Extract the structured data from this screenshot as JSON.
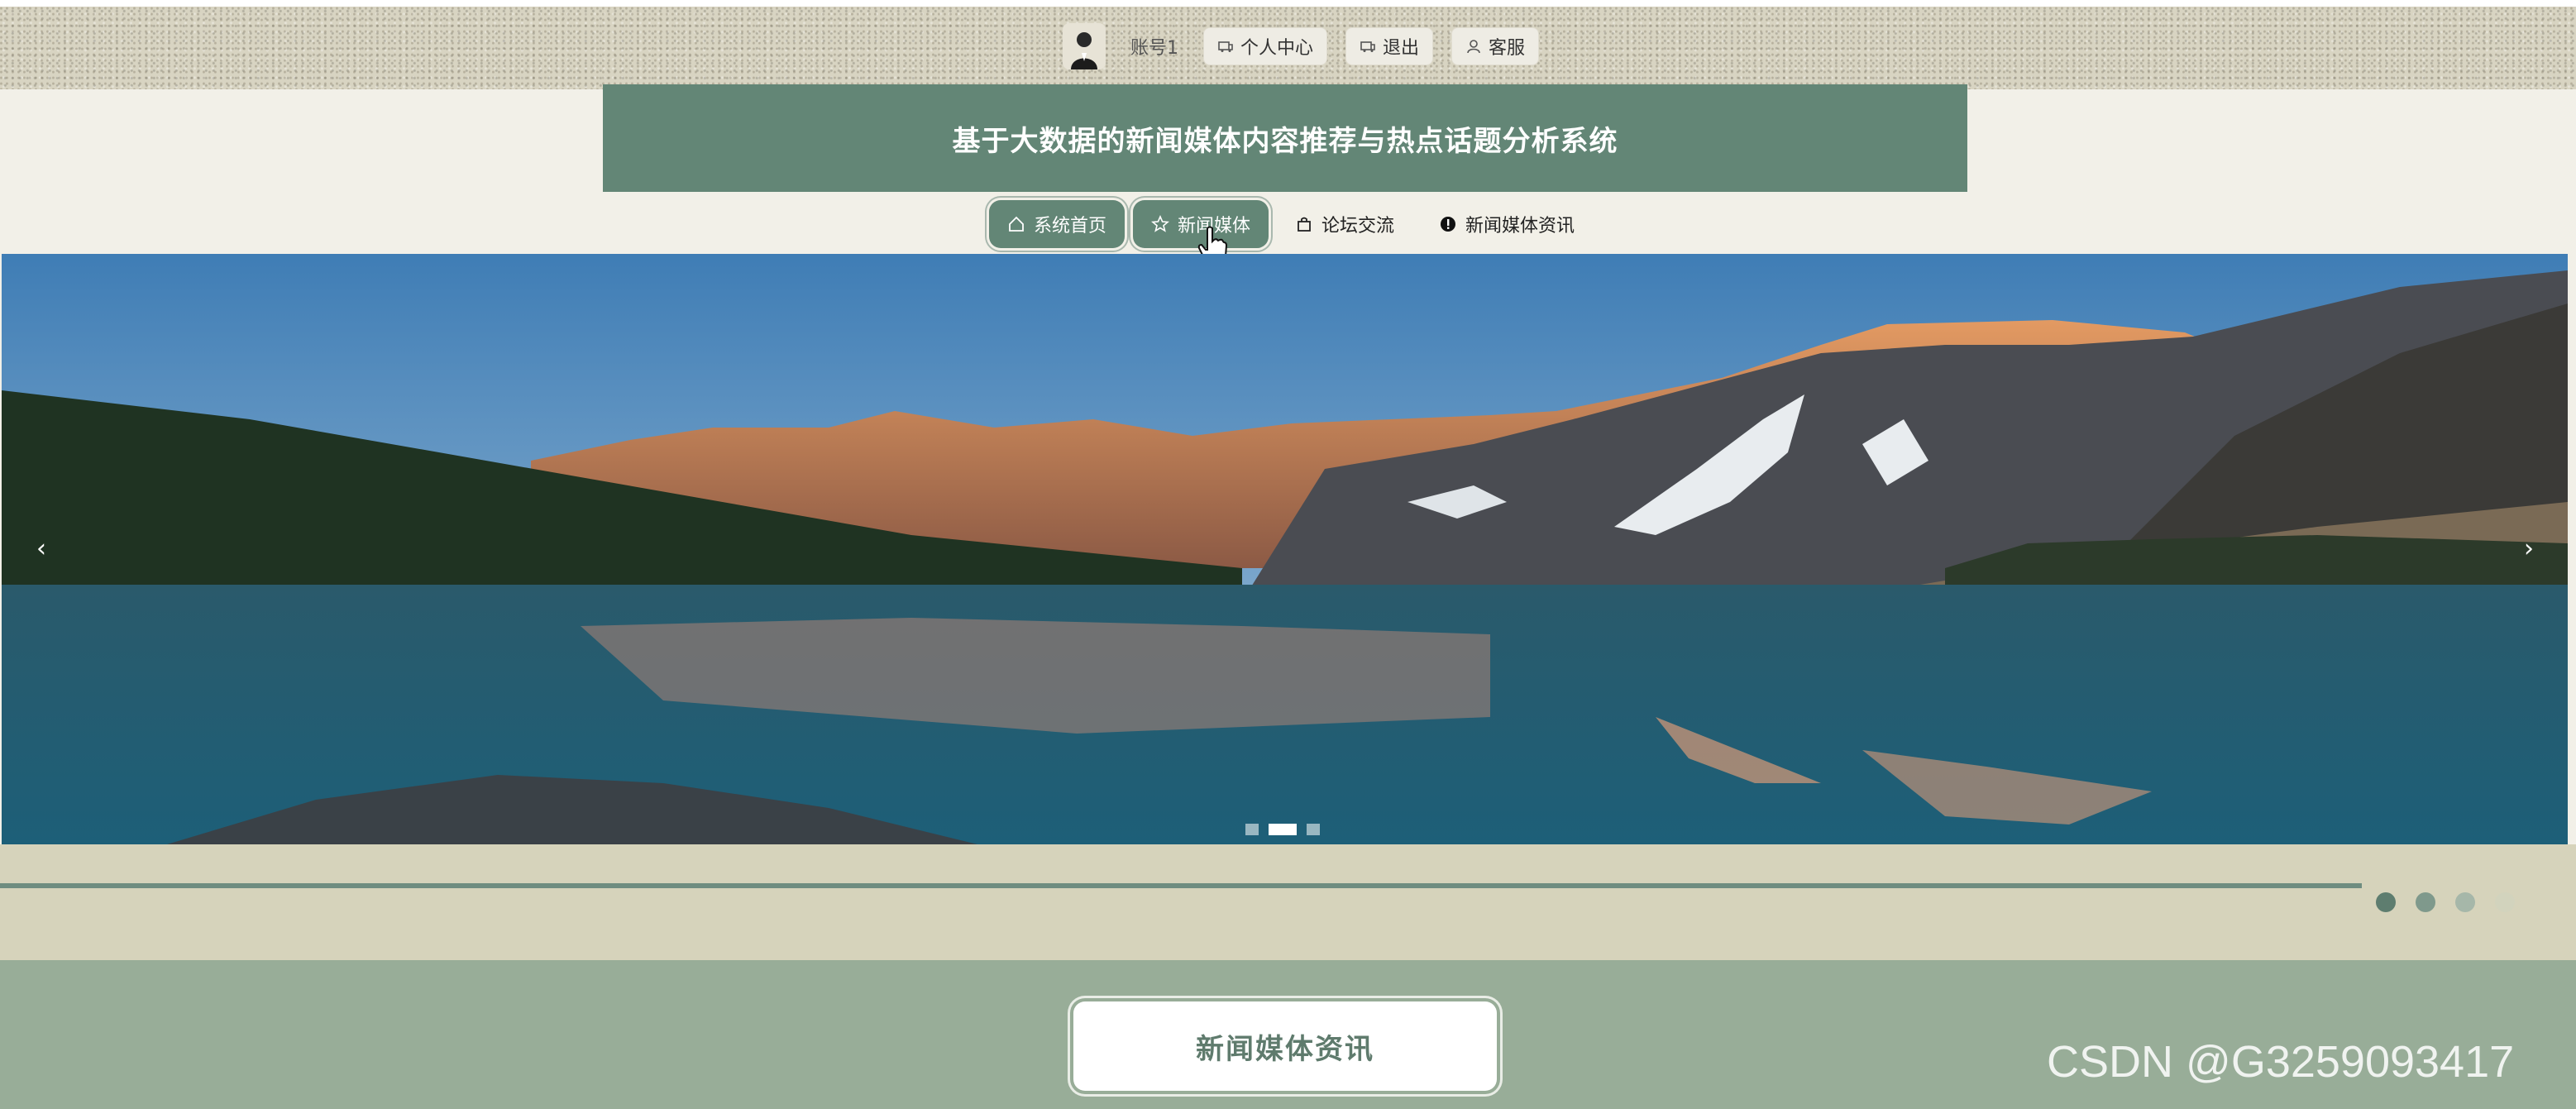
{
  "user_bar": {
    "account_name": "账号1",
    "buttons": [
      {
        "label": "个人中心",
        "icon": "personal-center-icon"
      },
      {
        "label": "退出",
        "icon": "logout-icon"
      },
      {
        "label": "客服",
        "icon": "customer-service-icon"
      }
    ]
  },
  "header": {
    "title": "基于大数据的新闻媒体内容推荐与热点话题分析系统"
  },
  "nav": {
    "items": [
      {
        "label": "系统首页",
        "icon": "home-icon",
        "active": true
      },
      {
        "label": "新闻媒体",
        "icon": "star-icon",
        "active": true
      },
      {
        "label": "论坛交流",
        "icon": "bag-icon",
        "active": false
      },
      {
        "label": "新闻媒体资讯",
        "icon": "info-icon",
        "active": false
      }
    ]
  },
  "carousel": {
    "prev_symbol": "‹",
    "next_symbol": "›",
    "slides": 3,
    "active_index": 1
  },
  "section": {
    "title": "新闻媒体资讯"
  },
  "watermark": "CSDN @G3259093417",
  "colors": {
    "primary": "#638676",
    "strip": "#d6d3bb",
    "section_bg": "#98ad98"
  }
}
